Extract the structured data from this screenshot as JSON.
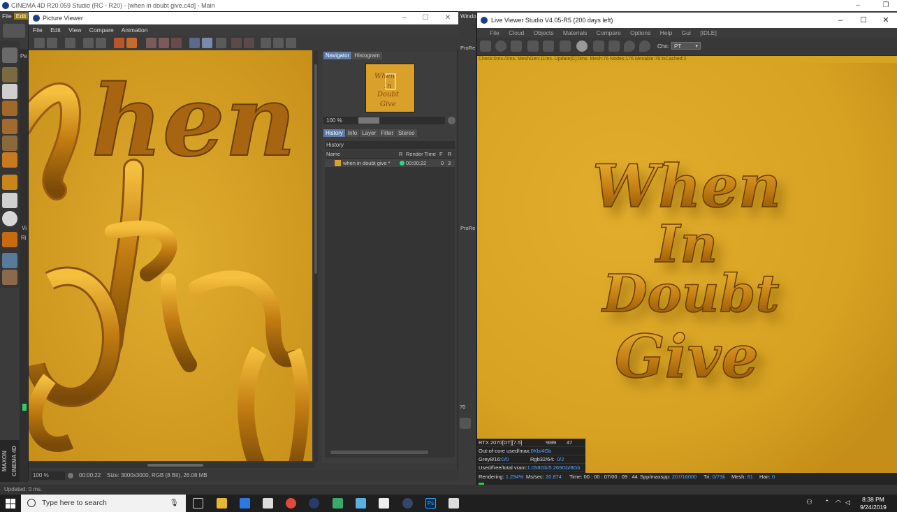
{
  "c4d": {
    "title": "CINEMA 4D R20.059 Studio (RC - R20) - [when in doubt give.c4d] - Main",
    "menu": [
      "File",
      "Edit"
    ],
    "status": "Updated: 0 ms.",
    "brand": "MAXON CINEMA 4D",
    "side_labels": [
      "Pe",
      "Vi",
      "Ri"
    ],
    "window_label": "Windo",
    "prores": "ProRe",
    "prores2": "ProRe",
    "num": "70"
  },
  "picture_viewer": {
    "title": "Picture Viewer",
    "menu": [
      "File",
      "Edit",
      "View",
      "Compare",
      "Animation"
    ],
    "nav_tabs": [
      "Navigator",
      "Histogram"
    ],
    "zoom": "100 %",
    "history_tabs": [
      "History",
      "Info",
      "Layer",
      "Filter",
      "Stereo"
    ],
    "history_heading": "History",
    "columns": [
      "Name",
      "R",
      "Render Time",
      "F",
      "R"
    ],
    "row": {
      "name": "when in doubt give *",
      "time": "00:00:22",
      "f": "0",
      "r": "3"
    },
    "bottom": {
      "zoom": "100 %",
      "time": "00:00:22",
      "size": "Size: 3000x3000, RGB (8 Bit), 26.08 MB"
    },
    "render_words": [
      "hen",
      "In"
    ]
  },
  "live_viewer": {
    "title": "Live Viewer Studio V4.05-R5 (200 days left)",
    "menu": [
      "File",
      "Cloud",
      "Objects",
      "Materials",
      "Compare",
      "Options",
      "Help",
      "Gui",
      "[IDLE]"
    ],
    "chn_label": "Chn:",
    "chn_value": "PT",
    "info": "Check:0ms./2ms. MeshGen:11ms. Update[C]:0ms. Mesh:76 Nodes:176 Movable:76 txCached:2",
    "render_words": [
      "When",
      "In",
      "Doubt",
      "Give"
    ],
    "stats": {
      "gpu": "RTX 2070[DT][7.5]",
      "gpu_pct": "%99",
      "gpu_temp": "47",
      "ooc_label": "Out-of-core used/max:",
      "ooc_val": "0Kb/4Gb",
      "grey_label": "Grey8/16:",
      "grey_val": "0/0",
      "rgb_label": "Rgb32/64:",
      "rgb_val": "0/2",
      "vram_label": "Used/free/total vram:",
      "vram_val": "1.058Gb/5.269Gb/8Gb"
    },
    "bottom": {
      "rendering_label": "Rendering:",
      "rendering": "1.294%",
      "ms_label": "Ms/sec:",
      "ms": "20.874",
      "time_label": "Time:",
      "time": "00 : 00 : 07/00 : 09 : 44",
      "spp_label": "Spp/maxspp:",
      "spp": "207/16000",
      "tri_label": "Tri:",
      "tri": "0/73k",
      "mesh_label": "Mesh:",
      "mesh": "81",
      "hair_label": "Hair:",
      "hair": "0"
    },
    "progress": 1.294
  },
  "taskbar": {
    "search_placeholder": "Type here to search",
    "time": "8:38 PM",
    "date": "9/24/2019"
  }
}
